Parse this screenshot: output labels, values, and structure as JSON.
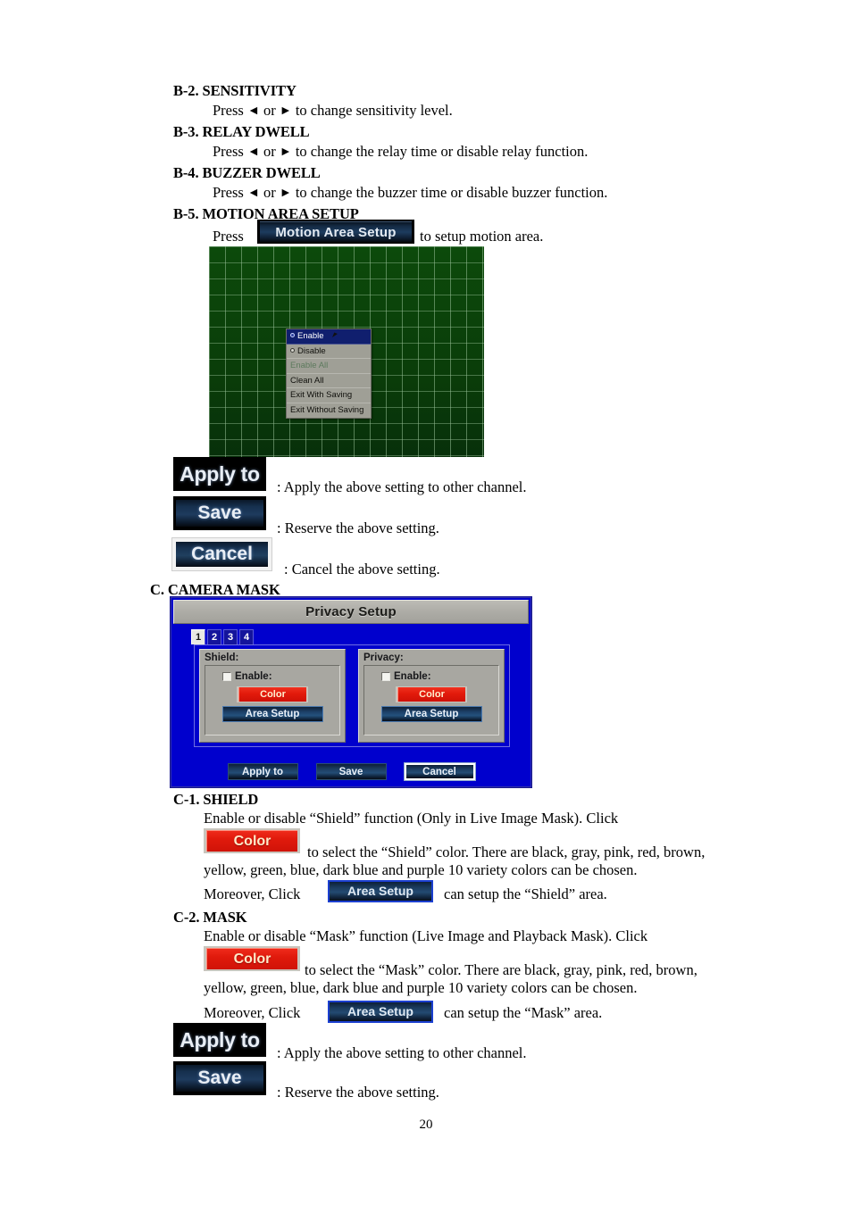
{
  "sections": {
    "b2": {
      "heading": "B-2. SENSITIVITY",
      "line_pre": "Press ",
      "left_arrow": "◄",
      "mid": " or ",
      "right_arrow": "►",
      "line_post": " to change sensitivity level."
    },
    "b3": {
      "heading": "B-3. RELAY DWELL",
      "line_pre": "Press ",
      "left_arrow": "◄",
      "mid": " or ",
      "right_arrow": "►",
      "line_post": " to change the relay time or disable relay function."
    },
    "b4": {
      "heading": "B-4. BUZZER DWELL",
      "line_pre": "Press ",
      "left_arrow": "◄",
      "mid": " or ",
      "right_arrow": "►",
      "line_post": " to change the buzzer time or disable buzzer function."
    },
    "b5": {
      "heading": "B-5. MOTION AREA SETUP",
      "press_label": "Press",
      "button_label": "Motion Area Setup",
      "after_button": "to setup motion area."
    },
    "c": {
      "heading": "C. CAMERA MASK"
    },
    "c1": {
      "heading": "C-1. SHIELD",
      "line1": "Enable or disable “Shield” function (Only in Live Image Mask). Click",
      "color_button": "Color",
      "line2": "to select the “Shield” color. There are black, gray, pink, red, brown,",
      "line3": "yellow, green, blue, dark blue and purple 10 variety colors can be chosen.",
      "line4_pre": "Moreover, Click",
      "area_button": "Area Setup",
      "line4_post": "can setup the “Shield” area."
    },
    "c2": {
      "heading": "C-2. MASK",
      "line1": "Enable or disable “Mask” function (Live Image and Playback Mask). Click",
      "color_button": "Color",
      "line2": "to select the “Mask” color. There are black, gray, pink, red, brown,",
      "line3": "yellow, green, blue, dark blue and purple 10 variety colors can be chosen.",
      "line4_pre": "Moreover, Click",
      "area_button": "Area Setup",
      "line4_post": "can setup the “Mask” area."
    }
  },
  "legend_buttons_motion": [
    {
      "label": "Apply to",
      "description": ": Apply the above setting to other channel."
    },
    {
      "label": "Save",
      "description": ": Reserve the above setting."
    },
    {
      "label": "Cancel",
      "description": ": Cancel the above setting."
    }
  ],
  "legend_buttons_mask": [
    {
      "label": "Apply to",
      "description": ": Apply the above setting to other channel."
    },
    {
      "label": "Save",
      "description": ": Reserve the above setting."
    }
  ],
  "motion_context_menu": {
    "items": [
      {
        "label": "Enable",
        "type": "radio",
        "selected": true,
        "dim": false
      },
      {
        "label": "Disable",
        "type": "radio",
        "selected": false,
        "dim": false
      },
      {
        "label": "Enable All",
        "type": "plain",
        "selected": false,
        "dim": true
      },
      {
        "label": "Clean All",
        "type": "plain",
        "selected": false,
        "dim": false
      },
      {
        "label": "Exit With Saving",
        "type": "plain",
        "selected": false,
        "dim": false
      },
      {
        "label": "Exit Without Saving",
        "type": "plain",
        "selected": false,
        "dim": false
      }
    ]
  },
  "privacy_dialog": {
    "title": "Privacy Setup",
    "tabs": [
      {
        "label": "1",
        "active": true
      },
      {
        "label": "2",
        "active": false
      },
      {
        "label": "3",
        "active": false
      },
      {
        "label": "4",
        "active": false
      }
    ],
    "groups": [
      {
        "title": "Shield:",
        "enable_label": "Enable:",
        "enable_checked": false,
        "color_button": "Color",
        "area_button": "Area Setup"
      },
      {
        "title": "Privacy:",
        "enable_label": "Enable:",
        "enable_checked": false,
        "color_button": "Color",
        "area_button": "Area Setup"
      }
    ],
    "footer_buttons": [
      {
        "label": "Apply to",
        "focused": false
      },
      {
        "label": "Save",
        "focused": false
      },
      {
        "label": "Cancel",
        "focused": true
      }
    ]
  },
  "colors": {
    "dialog_blue": "#0000cd",
    "titlebar_gray": "#a8a7a1",
    "color_button_red": "#e21a0b",
    "grid_green": "#0a420a",
    "menu_highlight": "#101f6e"
  },
  "page_number": "20"
}
